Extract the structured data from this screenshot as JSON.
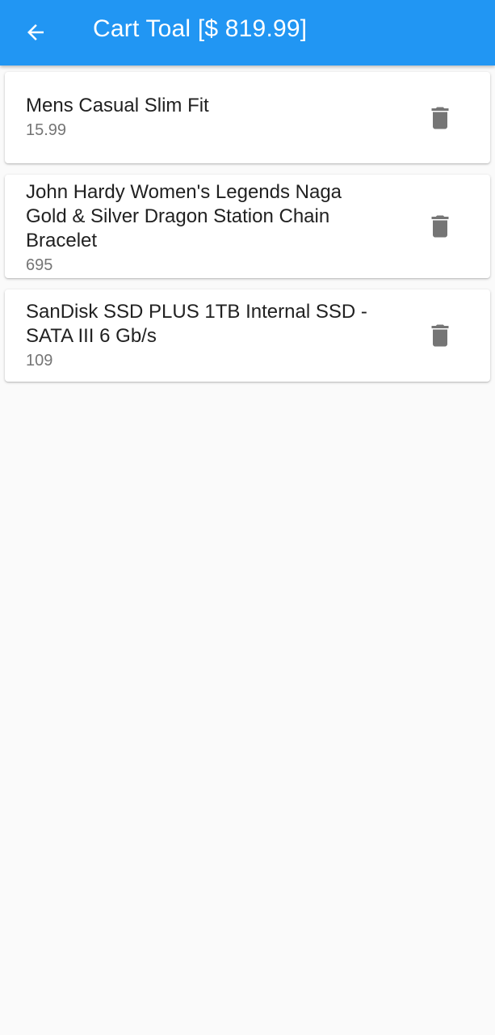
{
  "app_bar": {
    "title": "Cart Toal [$ 819.99]",
    "back_icon": "arrow-back-icon",
    "background_color": "#2196f3"
  },
  "cart": {
    "items": [
      {
        "name": "Mens Casual Slim Fit",
        "price": "15.99",
        "delete_icon": "trash-icon"
      },
      {
        "name": "John Hardy Women's Legends Naga Gold & Silver Dragon Station Chain Bracelet",
        "price": "695",
        "delete_icon": "trash-icon"
      },
      {
        "name": "SanDisk SSD PLUS 1TB Internal SSD - SATA III 6 Gb/s",
        "price": "109",
        "delete_icon": "trash-icon"
      }
    ]
  },
  "colors": {
    "icon_gray": "#757575",
    "text_primary": "#212121",
    "page_background": "#fafafa"
  }
}
